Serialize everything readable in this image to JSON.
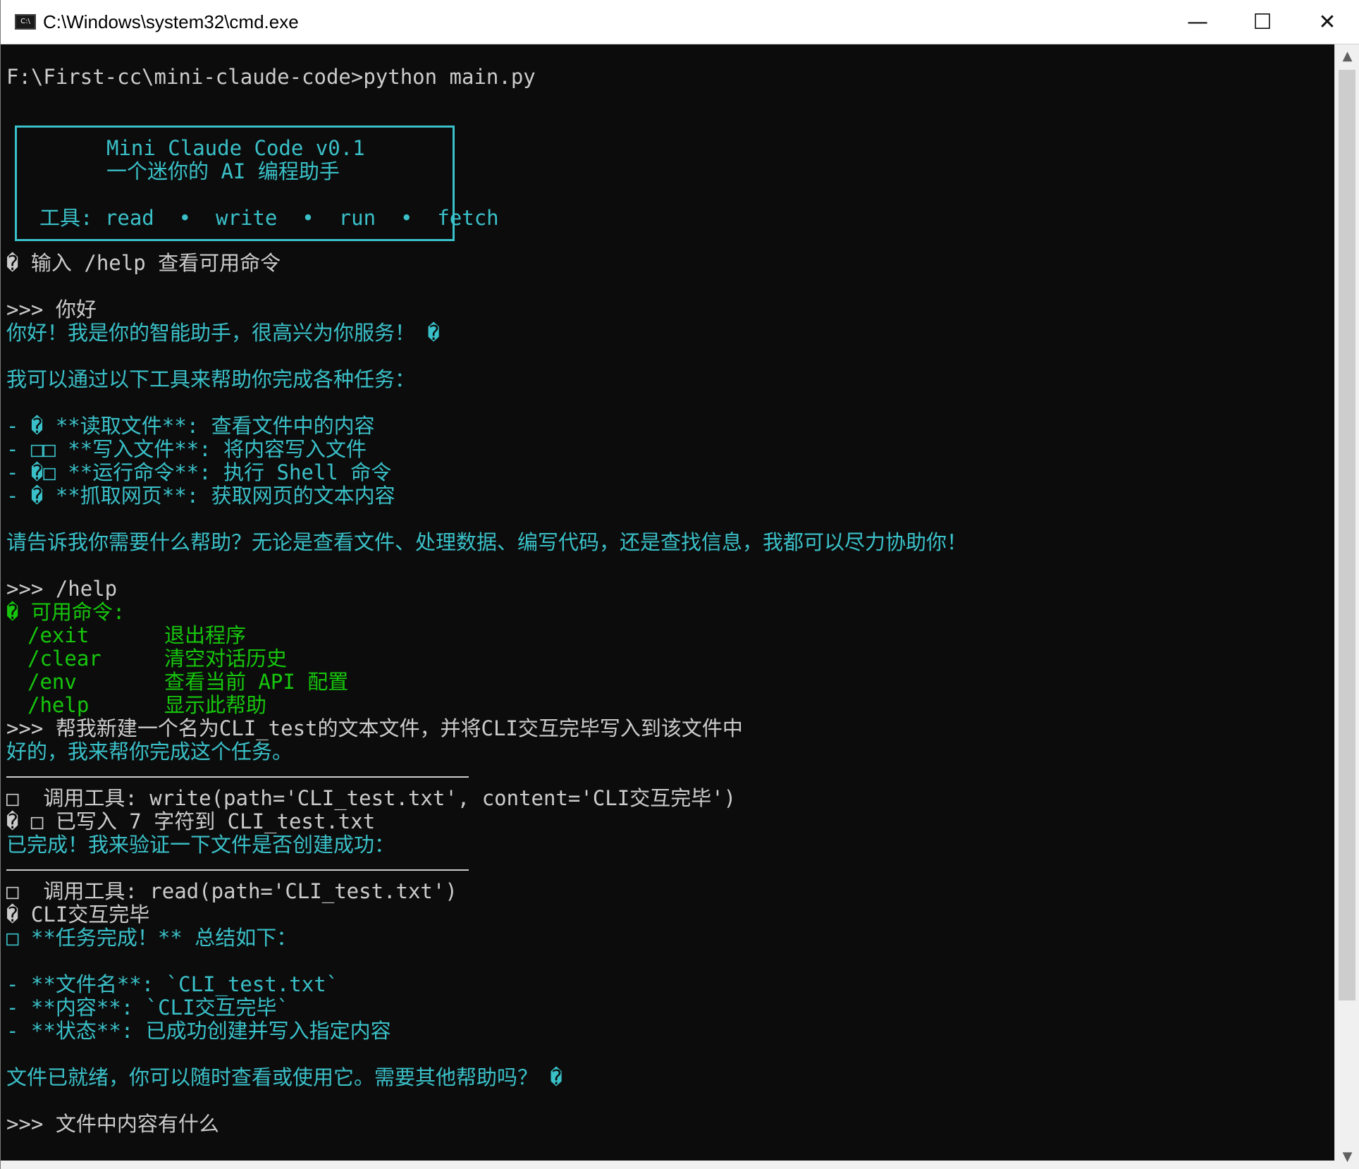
{
  "window": {
    "title": "C:\\Windows\\system32\\cmd.exe",
    "icon": "console-icon",
    "minimize_glyph": "—",
    "maximize_glyph": "☐",
    "close_glyph": "✕"
  },
  "console": {
    "prompt_line": "F:\\First-cc\\mini-claude-code>python main.py",
    "banner": {
      "title": "Mini Claude Code v0.1",
      "subtitle": "一个迷你的 AI 编程助手",
      "tools": "工具: read  •  write  •  run  •  fetch"
    },
    "hint": "� 输入 /help 查看可用命令",
    "user1": ">>> 你好",
    "reply1_l1": "你好！我是你的智能助手，很高兴为你服务！ �",
    "reply1_l2": "我可以通过以下工具来帮助你完成各种任务：",
    "reply1_b1": "- � **读取文件**: 查看文件中的内容",
    "reply1_b2": "- □□ **写入文件**: 将内容写入文件",
    "reply1_b3": "- �□ **运行命令**: 执行 Shell 命令",
    "reply1_b4": "- � **抓取网页**: 获取网页的文本内容",
    "reply1_l3": "请告诉我你需要什么帮助？无论是查看文件、处理数据、编写代码，还是查找信息，我都可以尽力协助你！",
    "user2": ">>> /help",
    "help_title": "� 可用命令:",
    "help_rows": [
      {
        "cmd": "/exit",
        "desc": "退出程序"
      },
      {
        "cmd": "/clear",
        "desc": "清空对话历史"
      },
      {
        "cmd": "/env",
        "desc": "查看当前 API 配置"
      },
      {
        "cmd": "/help",
        "desc": "显示此帮助"
      }
    ],
    "user3": ">>> 帮我新建一个名为CLI_test的文本文件，并将CLI交互完毕写入到该文件中",
    "reply3_l1": "好的，我来帮你完成这个任务。",
    "tool1_call": "□  调用工具: write(path='CLI_test.txt', content='CLI交互完毕')",
    "tool1_result": "� □ 已写入 7 字符到 CLI_test.txt",
    "reply3_l2": "已完成！我来验证一下文件是否创建成功：",
    "tool2_call": "□  调用工具: read(path='CLI_test.txt')",
    "tool2_result": "� CLI交互完毕",
    "reply3_l3": "□ **任务完成！** 总结如下：",
    "reply3_b1": "- **文件名**: `CLI_test.txt`",
    "reply3_b2": "- **内容**: `CLI交互完毕`",
    "reply3_b3": "- **状态**: 已成功创建并写入指定内容",
    "reply3_l4": "文件已就绪，你可以随时查看或使用它。需要其他帮助吗？ �",
    "user4": ">>> 文件中内容有什么"
  },
  "scrollbar": {
    "up_glyph": "▲",
    "down_glyph": "▼"
  },
  "colors": {
    "background": "#0c0c0c",
    "text_default": "#cccccc",
    "text_cyan": "#3ac0c8",
    "text_green": "#16c60c"
  }
}
